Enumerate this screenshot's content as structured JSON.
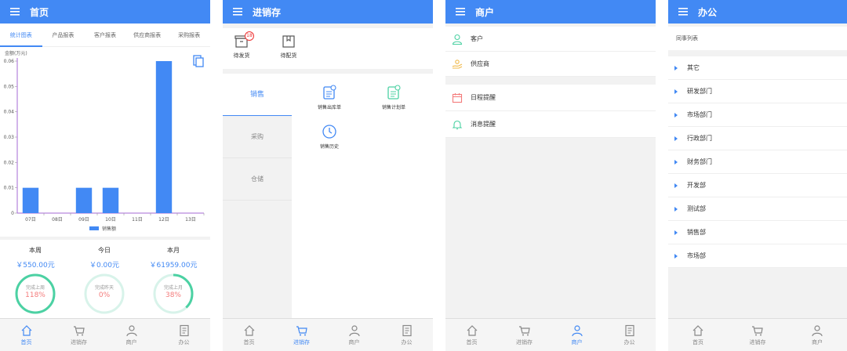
{
  "home": {
    "title": "首页",
    "tabs": [
      "统计图表",
      "产品报表",
      "客户报表",
      "供应商报表",
      "采购报表"
    ],
    "chart_unit": "金额(万元)",
    "stats": [
      {
        "label": "本周",
        "amount": "￥550.00元",
        "ring_text": "完成上周",
        "pct": "118%",
        "fraction": 1.0
      },
      {
        "label": "今日",
        "amount": "￥0.00元",
        "ring_text": "完成昨天",
        "pct": "0%",
        "fraction": 0.0
      },
      {
        "label": "本月",
        "amount": "￥61959.00元",
        "ring_text": "完成上月",
        "pct": "38%",
        "fraction": 0.38
      }
    ]
  },
  "chart_data": {
    "type": "bar",
    "categories": [
      "07日",
      "08日",
      "09日",
      "10日",
      "11日",
      "12日",
      "13日"
    ],
    "series": [
      {
        "name": "销售额",
        "values": [
          0.01,
          0,
          0.01,
          0.01,
          0,
          0.06,
          0
        ]
      }
    ],
    "ylabel": "金额(万元)",
    "yticks": [
      "0",
      "0.01",
      "0.02",
      "0.03",
      "0.04",
      "0.05",
      "0.06"
    ],
    "ylim": [
      0,
      0.06
    ],
    "legend": "bottom-center",
    "color": "#4289f4"
  },
  "inventory": {
    "title": "进销存",
    "quick": [
      {
        "label": "待发货",
        "badge": "18"
      },
      {
        "label": "待配货"
      }
    ],
    "categories": [
      "销售",
      "采购",
      "仓储"
    ],
    "panel_items": [
      "销售出库单",
      "销售计划单",
      "销售历史"
    ]
  },
  "merchant": {
    "title": "商户",
    "group1": [
      "客户",
      "供应商"
    ],
    "group2": [
      "日程提醒",
      "消息提醒"
    ]
  },
  "office": {
    "title": "办公",
    "section": "同事列表",
    "departments": [
      "其它",
      "研发部门",
      "市场部门",
      "行政部门",
      "财务部门",
      "开发部",
      "测试部",
      "销售部",
      "市场部"
    ]
  },
  "nav": [
    "首页",
    "进销存",
    "商户",
    "办公"
  ],
  "colors": {
    "primary": "#4289f4",
    "ring": "#4cd1a3",
    "ring_bg": "#d8f3ea",
    "pct": "#f47b7b"
  }
}
